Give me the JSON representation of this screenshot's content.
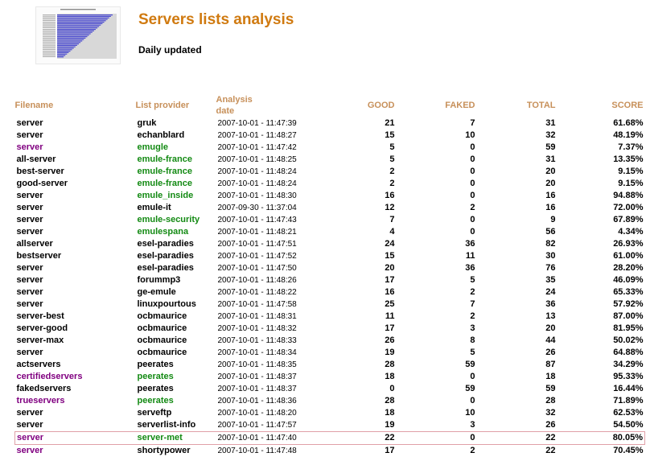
{
  "header": {
    "title": "Servers lists analysis",
    "subtitle": "Daily updated",
    "thumbnail_icon": "chart-thumbnail-icon"
  },
  "colors": {
    "title": "#d07a10",
    "column_header": "#c7905a",
    "purple_text": "#800080",
    "green_text": "#138a13",
    "highlight_border": "#e0a0a8"
  },
  "table": {
    "columns": [
      "Filename",
      "List provider",
      "Analysis date",
      "GOOD",
      "FAKED",
      "TOTAL",
      "SCORE"
    ],
    "rows": [
      {
        "filename": "server",
        "provider": "gruk",
        "date": "2007-10-01 - 11:47:39",
        "good": "21",
        "faked": "7",
        "total": "31",
        "score": "61.68%",
        "fn_purple": false,
        "prov_green": false,
        "highlight": false
      },
      {
        "filename": "server",
        "provider": "echanblard",
        "date": "2007-10-01 - 11:48:27",
        "good": "15",
        "faked": "10",
        "total": "32",
        "score": "48.19%",
        "fn_purple": false,
        "prov_green": false,
        "highlight": false
      },
      {
        "filename": "server",
        "provider": "emugle",
        "date": "2007-10-01 - 11:47:42",
        "good": "5",
        "faked": "0",
        "total": "59",
        "score": "7.37%",
        "fn_purple": true,
        "prov_green": true,
        "highlight": false
      },
      {
        "filename": "all-server",
        "provider": "emule-france",
        "date": "2007-10-01 - 11:48:25",
        "good": "5",
        "faked": "0",
        "total": "31",
        "score": "13.35%",
        "fn_purple": false,
        "prov_green": true,
        "highlight": false
      },
      {
        "filename": "best-server",
        "provider": "emule-france",
        "date": "2007-10-01 - 11:48:24",
        "good": "2",
        "faked": "0",
        "total": "20",
        "score": "9.15%",
        "fn_purple": false,
        "prov_green": true,
        "highlight": false
      },
      {
        "filename": "good-server",
        "provider": "emule-france",
        "date": "2007-10-01 - 11:48:24",
        "good": "2",
        "faked": "0",
        "total": "20",
        "score": "9.15%",
        "fn_purple": false,
        "prov_green": true,
        "highlight": false
      },
      {
        "filename": "server",
        "provider": "emule_inside",
        "date": "2007-10-01 - 11:48:30",
        "good": "16",
        "faked": "0",
        "total": "16",
        "score": "94.88%",
        "fn_purple": false,
        "prov_green": true,
        "highlight": false
      },
      {
        "filename": "server",
        "provider": "emule-it",
        "date": "2007-09-30 - 11:37:04",
        "good": "12",
        "faked": "2",
        "total": "16",
        "score": "72.00%",
        "fn_purple": false,
        "prov_green": false,
        "highlight": false
      },
      {
        "filename": "server",
        "provider": "emule-security",
        "date": "2007-10-01 - 11:47:43",
        "good": "7",
        "faked": "0",
        "total": "9",
        "score": "67.89%",
        "fn_purple": false,
        "prov_green": true,
        "highlight": false
      },
      {
        "filename": "server",
        "provider": "emulespana",
        "date": "2007-10-01 - 11:48:21",
        "good": "4",
        "faked": "0",
        "total": "56",
        "score": "4.34%",
        "fn_purple": false,
        "prov_green": true,
        "highlight": false
      },
      {
        "filename": "allserver",
        "provider": "esel-paradies",
        "date": "2007-10-01 - 11:47:51",
        "good": "24",
        "faked": "36",
        "total": "82",
        "score": "26.93%",
        "fn_purple": false,
        "prov_green": false,
        "highlight": false
      },
      {
        "filename": "bestserver",
        "provider": "esel-paradies",
        "date": "2007-10-01 - 11:47:52",
        "good": "15",
        "faked": "11",
        "total": "30",
        "score": "61.00%",
        "fn_purple": false,
        "prov_green": false,
        "highlight": false
      },
      {
        "filename": "server",
        "provider": "esel-paradies",
        "date": "2007-10-01 - 11:47:50",
        "good": "20",
        "faked": "36",
        "total": "76",
        "score": "28.20%",
        "fn_purple": false,
        "prov_green": false,
        "highlight": false
      },
      {
        "filename": "server",
        "provider": "forummp3",
        "date": "2007-10-01 - 11:48:26",
        "good": "17",
        "faked": "5",
        "total": "35",
        "score": "46.09%",
        "fn_purple": false,
        "prov_green": false,
        "highlight": false
      },
      {
        "filename": "server",
        "provider": "ge-emule",
        "date": "2007-10-01 - 11:48:22",
        "good": "16",
        "faked": "2",
        "total": "24",
        "score": "65.33%",
        "fn_purple": false,
        "prov_green": false,
        "highlight": false
      },
      {
        "filename": "server",
        "provider": "linuxpourtous",
        "date": "2007-10-01 - 11:47:58",
        "good": "25",
        "faked": "7",
        "total": "36",
        "score": "57.92%",
        "fn_purple": false,
        "prov_green": false,
        "highlight": false
      },
      {
        "filename": "server-best",
        "provider": "ocbmaurice",
        "date": "2007-10-01 - 11:48:31",
        "good": "11",
        "faked": "2",
        "total": "13",
        "score": "87.00%",
        "fn_purple": false,
        "prov_green": false,
        "highlight": false
      },
      {
        "filename": "server-good",
        "provider": "ocbmaurice",
        "date": "2007-10-01 - 11:48:32",
        "good": "17",
        "faked": "3",
        "total": "20",
        "score": "81.95%",
        "fn_purple": false,
        "prov_green": false,
        "highlight": false
      },
      {
        "filename": "server-max",
        "provider": "ocbmaurice",
        "date": "2007-10-01 - 11:48:33",
        "good": "26",
        "faked": "8",
        "total": "44",
        "score": "50.02%",
        "fn_purple": false,
        "prov_green": false,
        "highlight": false
      },
      {
        "filename": "server",
        "provider": "ocbmaurice",
        "date": "2007-10-01 - 11:48:34",
        "good": "19",
        "faked": "5",
        "total": "26",
        "score": "64.88%",
        "fn_purple": false,
        "prov_green": false,
        "highlight": false
      },
      {
        "filename": "actservers",
        "provider": "peerates",
        "date": "2007-10-01 - 11:48:35",
        "good": "28",
        "faked": "59",
        "total": "87",
        "score": "34.29%",
        "fn_purple": false,
        "prov_green": false,
        "highlight": false
      },
      {
        "filename": "certifiedservers",
        "provider": "peerates",
        "date": "2007-10-01 - 11:48:37",
        "good": "18",
        "faked": "0",
        "total": "18",
        "score": "95.33%",
        "fn_purple": true,
        "prov_green": true,
        "highlight": false
      },
      {
        "filename": "fakedservers",
        "provider": "peerates",
        "date": "2007-10-01 - 11:48:37",
        "good": "0",
        "faked": "59",
        "total": "59",
        "score": "16.44%",
        "fn_purple": false,
        "prov_green": false,
        "highlight": false
      },
      {
        "filename": "trueservers",
        "provider": "peerates",
        "date": "2007-10-01 - 11:48:36",
        "good": "28",
        "faked": "0",
        "total": "28",
        "score": "71.89%",
        "fn_purple": true,
        "prov_green": true,
        "highlight": false
      },
      {
        "filename": "server",
        "provider": "serveftp",
        "date": "2007-10-01 - 11:48:20",
        "good": "18",
        "faked": "10",
        "total": "32",
        "score": "62.53%",
        "fn_purple": false,
        "prov_green": false,
        "highlight": false
      },
      {
        "filename": "server",
        "provider": "serverlist-info",
        "date": "2007-10-01 - 11:47:57",
        "good": "19",
        "faked": "3",
        "total": "26",
        "score": "54.50%",
        "fn_purple": false,
        "prov_green": false,
        "highlight": false
      },
      {
        "filename": "server",
        "provider": "server-met",
        "date": "2007-10-01 - 11:47:40",
        "good": "22",
        "faked": "0",
        "total": "22",
        "score": "80.05%",
        "fn_purple": true,
        "prov_green": true,
        "highlight": true
      },
      {
        "filename": "server",
        "provider": "shortypower",
        "date": "2007-10-01 - 11:47:48",
        "good": "17",
        "faked": "2",
        "total": "22",
        "score": "70.45%",
        "fn_purple": true,
        "prov_green": false,
        "highlight": false
      }
    ]
  }
}
